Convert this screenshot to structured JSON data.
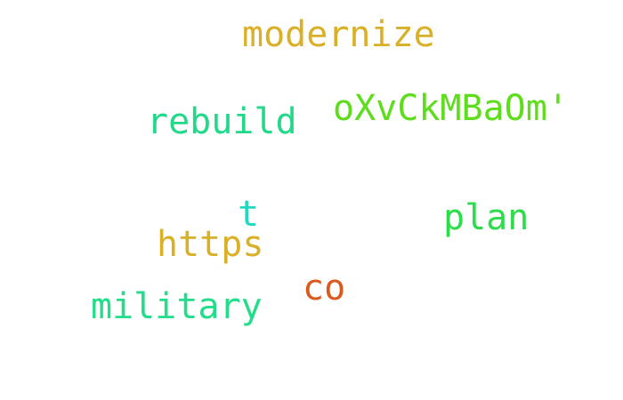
{
  "words": [
    {
      "text": "modernize",
      "color": "#d9b027"
    },
    {
      "text": "oXvCkMBaOm'",
      "color": "#5edd1c"
    },
    {
      "text": "rebuild",
      "color": "#22d98a"
    },
    {
      "text": "t",
      "color": "#22d9c0"
    },
    {
      "text": "plan",
      "color": "#2cdd4a"
    },
    {
      "text": "https",
      "color": "#d9b027"
    },
    {
      "text": "co",
      "color": "#d95a1c"
    },
    {
      "text": "military",
      "color": "#22dd8a"
    }
  ]
}
